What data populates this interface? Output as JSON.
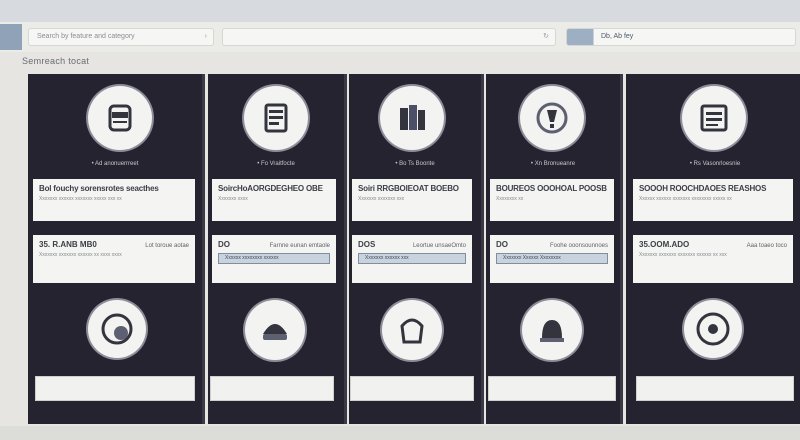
{
  "toolbar": {
    "filter_text": "Search by feature and category",
    "search_placeholder": "",
    "right_field_text": "Db, Ab fey"
  },
  "section_title": "Semreach tocat",
  "columns": [
    {
      "icon": "coffee-cup-icon",
      "caption": "• Ad anonuerrreet",
      "card1_title": "Bol fouchy sorensrotes seacthes",
      "card1_sub": "Xxxxxxx xxxxxx xxxxxxx xxxxx xxx xx",
      "amount": "35. R.ANB MB0",
      "amount_note": "Lot toroue aotae",
      "card2_sub": "Xxxxxxx xxxxxxx xxxxxx xx xxxx xxxx",
      "bar_text": "",
      "bottom_icon": "donut-icon"
    },
    {
      "icon": "printer-icon",
      "caption": "• Fo Vraitfocte",
      "card1_title": "SoircHoAORGDEGHEO OBE",
      "card1_sub": "Xxxxxxx xxxx",
      "amount": "DO",
      "amount_note": "Farnne eunan emtaole",
      "card2_sub": "",
      "bar_text": "Xxxxxx xxxxxxxx xxxxxx",
      "bottom_icon": "helmet-icon"
    },
    {
      "icon": "files-icon",
      "caption": "• Bo Ts Boonte",
      "card1_title": "Soiri RRGBOIEOAT BOEBO",
      "card1_sub": "Xxxxxxx xxxxxxx xxx",
      "amount": "DOS",
      "amount_note": "Leortue unsaeOmto",
      "card2_sub": "",
      "bar_text": "Xxxxxxx xxxxxx xxx",
      "bottom_icon": "basket-icon"
    },
    {
      "icon": "lightbulb-icon",
      "caption": "• Xn Bronueanre",
      "card1_title": "BOUREOS OOOHOAL POOSB",
      "card1_sub": "Xxxxxxxx xx",
      "amount": "DO",
      "amount_note": "Foohe ooonsounnoes",
      "card2_sub": "",
      "bar_text": "Xxxxxxx Xxxxxx Xxxxxxxx",
      "bottom_icon": "bell-icon"
    },
    {
      "icon": "document-stack-icon",
      "caption": "• Rs Vasonrloesnie",
      "card1_title": "SOOOH ROOCHDAOES REASHOS",
      "card1_sub": "Xxxxxx xxxxxx xxxxxxx xxxxxxxx xxxxx xx",
      "amount": "35.OOM.ADO",
      "amount_note": "Aaa toaeo toco",
      "card2_sub": "Xxxxxxx xxxxxxx xxxxxxx xxxxxx xx xxx",
      "bar_text": "",
      "bottom_icon": "dial-icon"
    }
  ]
}
